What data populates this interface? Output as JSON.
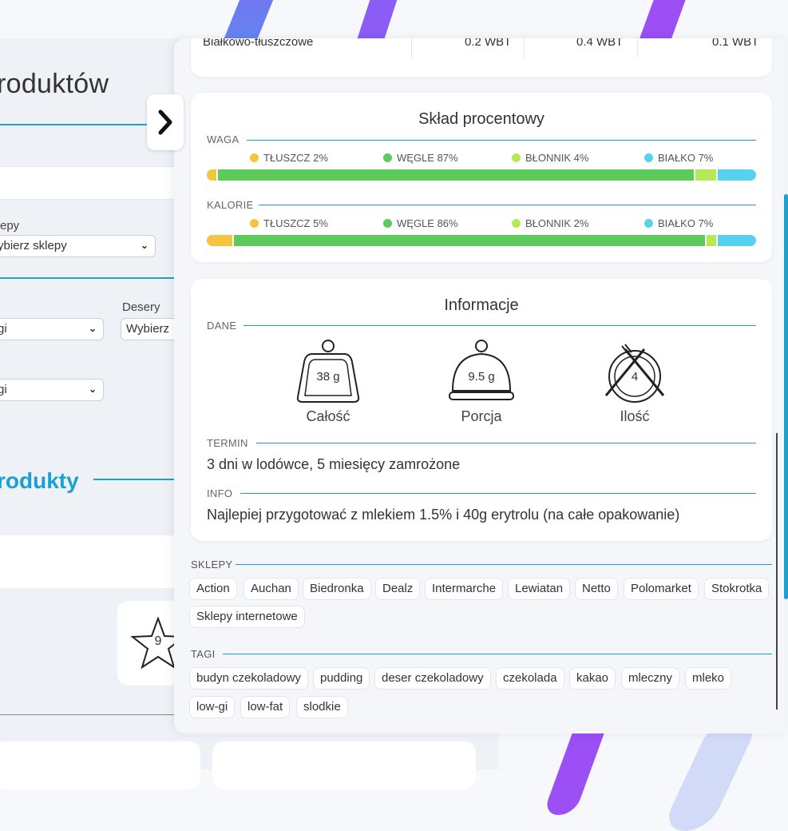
{
  "background": {
    "title_fragment": "roduktów",
    "shops_label_fragment": "epy",
    "shops_select_value": "ybierz sklepy",
    "tags_select_value_1": "gi",
    "tags_select_value_2": "gi",
    "desserts_label": "Desery",
    "desserts_select_value": "Wybierz",
    "section_fragment": "rodukty",
    "star_value": "9"
  },
  "macro_table_row": {
    "label": "Białkowo-tłuszczowe",
    "values": [
      "0.2 WBT",
      "0.4 WBT",
      "0.1 WBT"
    ]
  },
  "composition": {
    "title": "Skład procentowy",
    "weight": {
      "label": "WAGA",
      "items": [
        {
          "name": "TŁUSZCZ 2%",
          "percent": 2,
          "color": "#f5c542"
        },
        {
          "name": "WĘGLE 87%",
          "percent": 87,
          "color": "#5bcb5b"
        },
        {
          "name": "BŁONNIK 4%",
          "percent": 4,
          "color": "#b5ea56"
        },
        {
          "name": "BIAŁKO 7%",
          "percent": 7,
          "color": "#56d2ee"
        }
      ]
    },
    "calories": {
      "label": "KALORIE",
      "items": [
        {
          "name": "TŁUSZCZ 5%",
          "percent": 5,
          "color": "#f5c542"
        },
        {
          "name": "WĘGLE 86%",
          "percent": 86,
          "color": "#5bcb5b"
        },
        {
          "name": "BŁONNIK 2%",
          "percent": 2,
          "color": "#b5ea56"
        },
        {
          "name": "BIAŁKO 7%",
          "percent": 7,
          "color": "#56d2ee"
        }
      ]
    }
  },
  "info": {
    "title": "Informacje",
    "data_label": "DANE",
    "total": {
      "value": "38 g",
      "label": "Całość"
    },
    "portion": {
      "value": "9.5 g",
      "label": "Porcja"
    },
    "count": {
      "value": "4",
      "label": "Ilość"
    },
    "term_label": "TERMIN",
    "term_text": "3 dni w lodówce, 5 miesięcy zamrożone",
    "info_label": "INFO",
    "info_text": "Najlepiej przygotować z mlekiem 1.5% i 40g erytrolu (na całe opakowanie)"
  },
  "shops": {
    "label": "SKLEPY",
    "items": [
      "Action",
      "Auchan",
      "Biedronka",
      "Dealz",
      "Intermarche",
      "Lewiatan",
      "Netto",
      "Polomarket",
      "Stokrotka",
      "Sklepy internetowe"
    ]
  },
  "tags": {
    "label": "TAGI",
    "items": [
      "budyn czekoladowy",
      "pudding",
      "deser czekoladowy",
      "czekolada",
      "kakao",
      "mleczny",
      "mleko",
      "low-gi",
      "low-fat",
      "slodkie"
    ]
  },
  "colors": {
    "accent": "#1aa0d1",
    "fat": "#f5c542",
    "carbs": "#5bcb5b",
    "fiber": "#b5ea56",
    "protein": "#56d2ee"
  }
}
